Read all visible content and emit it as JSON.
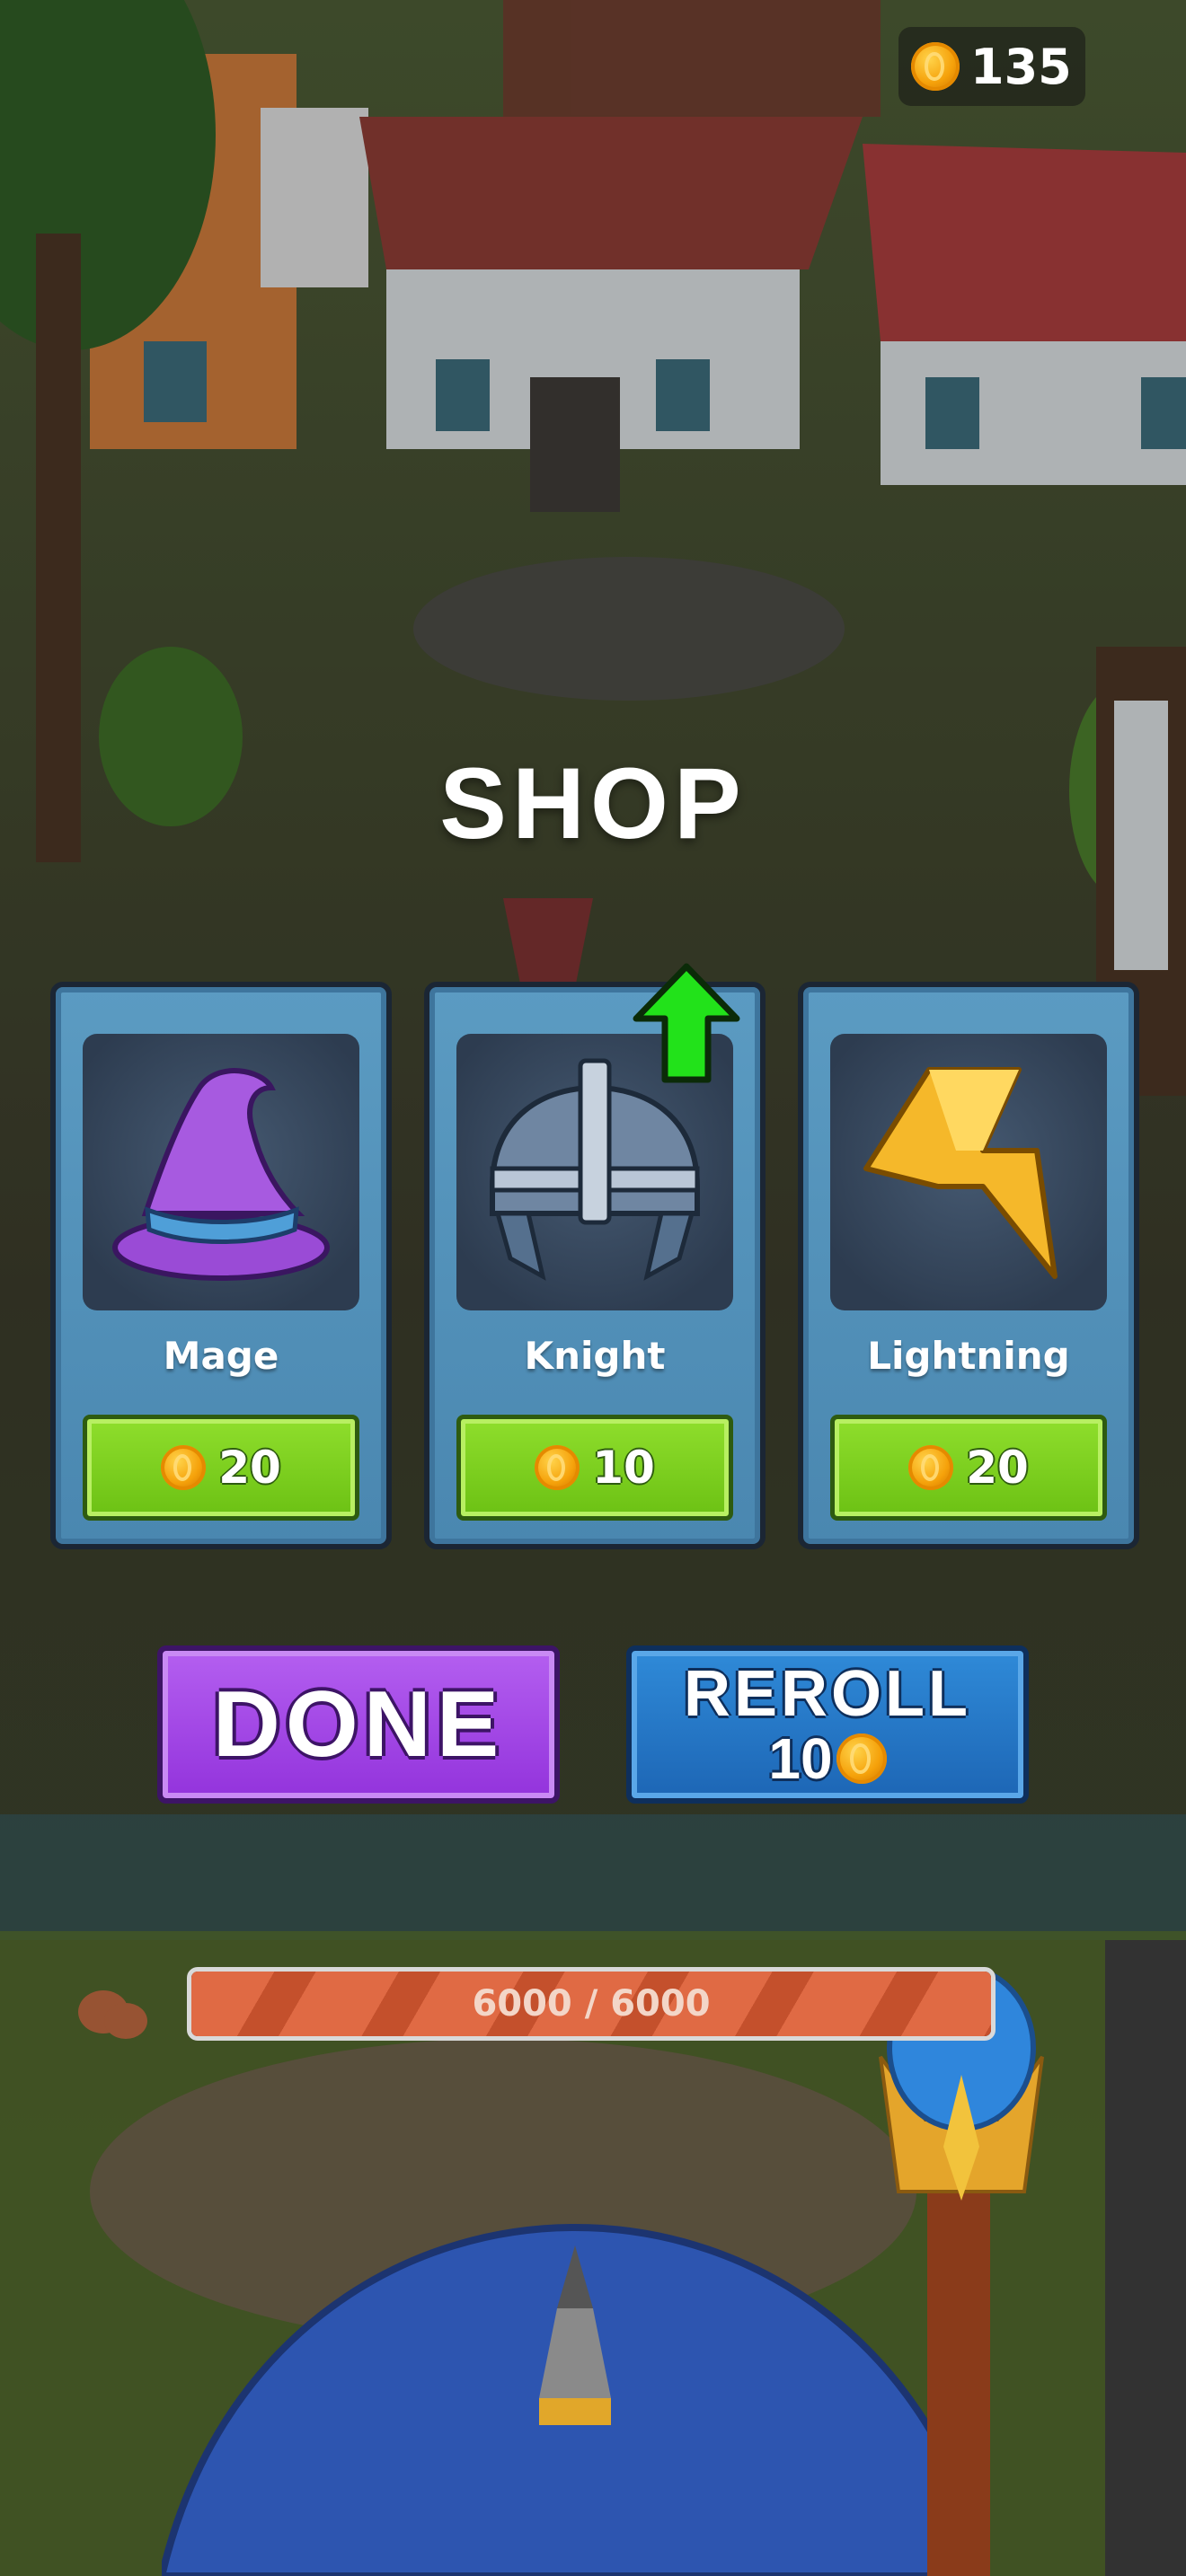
{
  "hud": {
    "coins": "135"
  },
  "shop": {
    "title": "SHOP",
    "cards": [
      {
        "name": "Mage",
        "price": "20",
        "icon": "wizard-hat-icon"
      },
      {
        "name": "Knight",
        "price": "10",
        "icon": "knight-helmet-icon",
        "upgrade_available": true
      },
      {
        "name": "Lightning",
        "price": "20",
        "icon": "lightning-bolt-icon"
      }
    ],
    "done_label": "DONE",
    "reroll_label": "REROLL",
    "reroll_cost": "10"
  },
  "health": {
    "current": 6000,
    "max": 6000,
    "text": "6000 / 6000",
    "fill_fraction": 1.0
  },
  "colors": {
    "card_bg": "#4a87b0",
    "price_button": "#7cd11f",
    "done_button": "#9f40e6",
    "reroll_button": "#2576c8",
    "health_fill": "#e06a44",
    "upgrade_arrow": "#22e21a"
  }
}
